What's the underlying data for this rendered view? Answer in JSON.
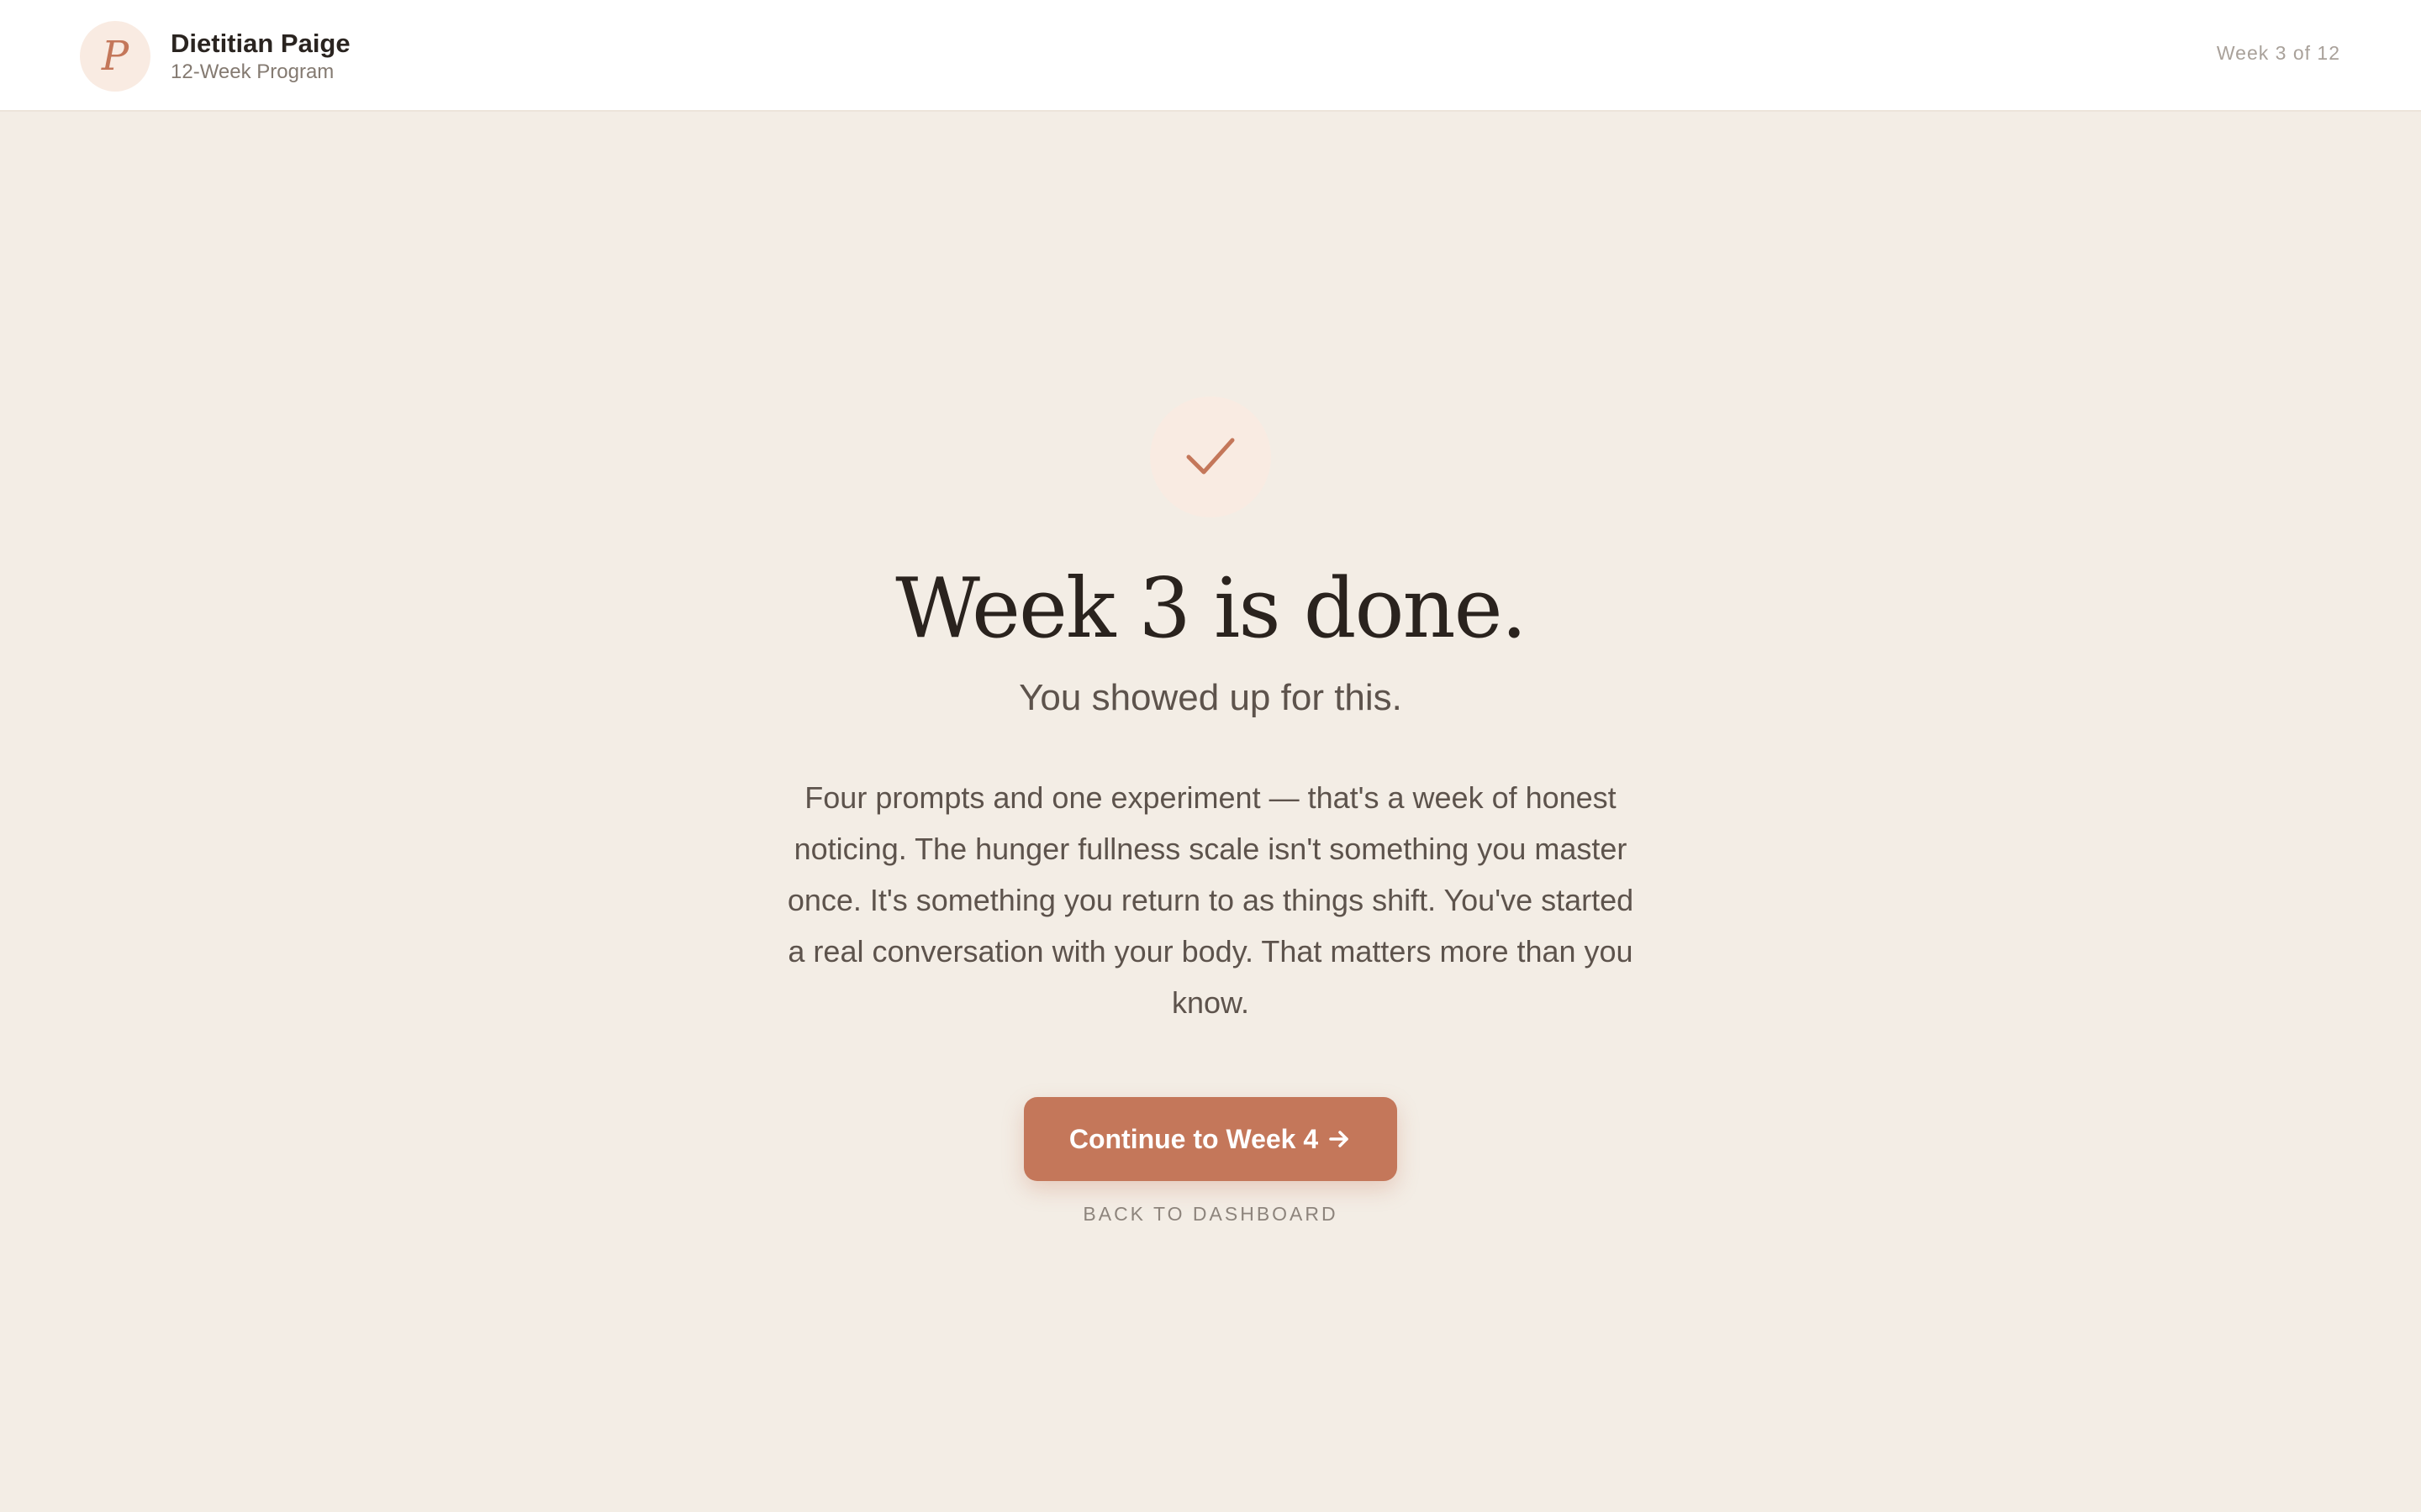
{
  "header": {
    "avatar_letter": "P",
    "brand_name": "Dietitian Paige",
    "brand_subtitle": "12-Week Program",
    "week_indicator": "Week 3 of 12"
  },
  "main": {
    "icon": "check-icon",
    "title": "Week 3 is done.",
    "subtitle": "You showed up for this.",
    "message": "Four prompts and one experiment — that's a week of honest noticing. The hunger fullness scale isn't something you master once. It's something you return to as things shift. You've started a real conversation with your body. That matters more than you know.",
    "cta_label": "Continue to Week 4",
    "cta_icon": "arrow-right-icon",
    "back_label": "BACK TO DASHBOARD"
  },
  "colors": {
    "accent": "#c4775a",
    "background": "#f3ede5",
    "accent_soft": "#f9ebe2",
    "heading": "#2a231e",
    "body_text": "#5d534c"
  }
}
